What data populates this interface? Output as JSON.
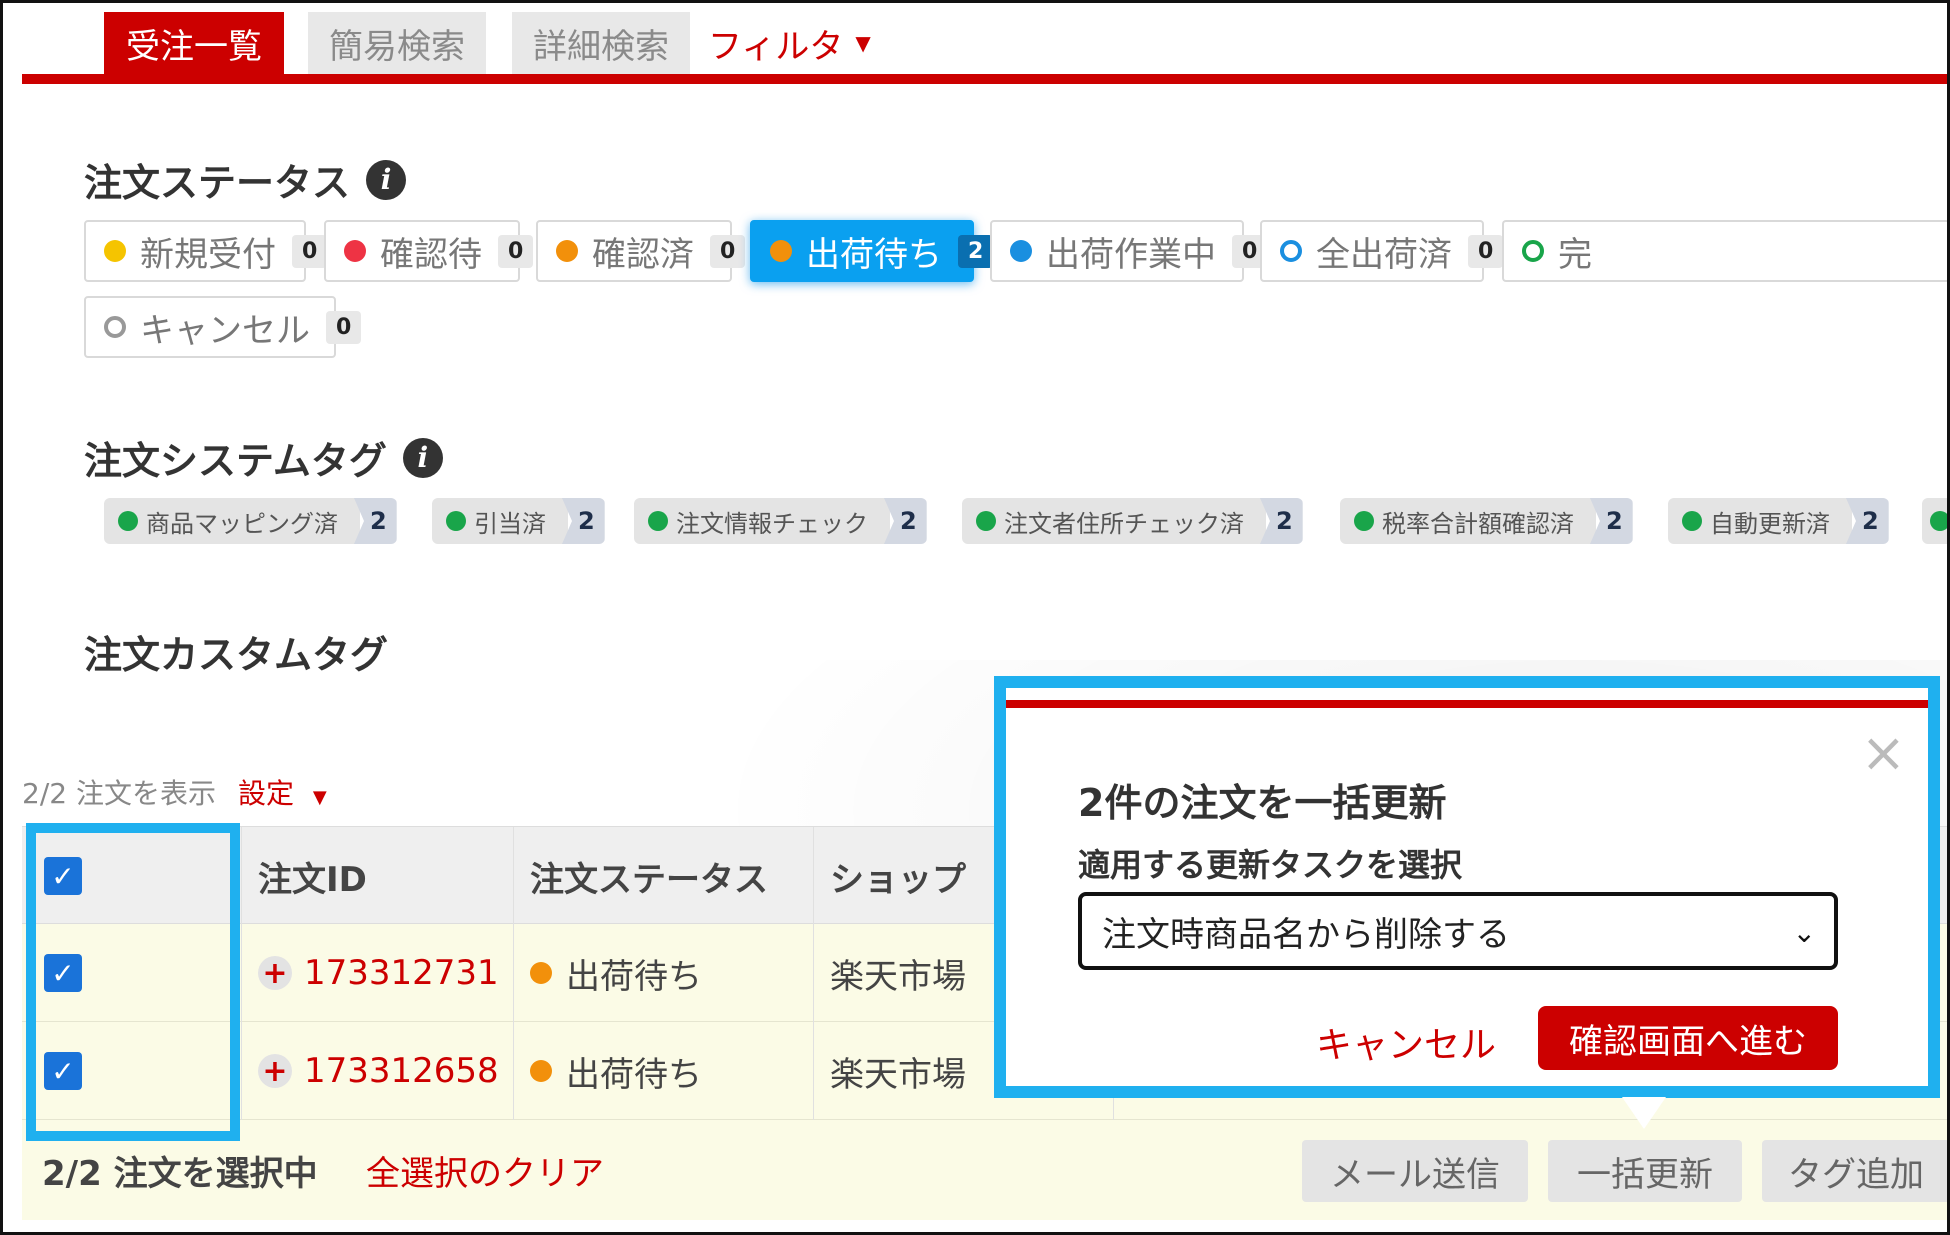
{
  "tabs": {
    "order_list": "受注一覧",
    "simple_search": "簡易検索",
    "detail_search": "詳細検索",
    "filter": "フィルタ",
    "caret": "▼"
  },
  "order_status": {
    "title": "注文ステータス",
    "info": "i",
    "chips": [
      {
        "label": "新規受付",
        "count": "0",
        "color": "#f5c400"
      },
      {
        "label": "確認待",
        "count": "0",
        "color": "#ee3344"
      },
      {
        "label": "確認済",
        "count": "0",
        "color": "#f2900b"
      },
      {
        "label": "出荷待ち",
        "count": "2",
        "color": "#f2900b"
      },
      {
        "label": "出荷作業中",
        "count": "0",
        "color": "#1a8fe0"
      },
      {
        "label": "全出荷済",
        "count": "0",
        "color": "#1a8fe0"
      },
      {
        "label": "完",
        "color": "#19a54a"
      },
      {
        "label": "キャンセル",
        "count": "0",
        "color": "#999999"
      }
    ]
  },
  "system_tags": {
    "title": "注文システムタグ",
    "info": "i",
    "tags": [
      {
        "label": "商品マッピング済",
        "count": "2"
      },
      {
        "label": "引当済",
        "count": "2"
      },
      {
        "label": "注文情報チェック",
        "count": "2"
      },
      {
        "label": "注文者住所チェック済",
        "count": "2"
      },
      {
        "label": "税率合計額確認済",
        "count": "2"
      },
      {
        "label": "自動更新済",
        "count": "2"
      }
    ]
  },
  "custom_tags": {
    "title": "注文カスタムタグ"
  },
  "list": {
    "count_text": "2/2 注文を表示",
    "settings": "設定",
    "caret": "▼"
  },
  "table": {
    "headers": {
      "order_id": "注文ID",
      "status": "注文ステータス",
      "shop": "ショップ"
    },
    "rows": [
      {
        "order_id": "173312731",
        "status": "出荷待ち",
        "shop": "楽天市場"
      },
      {
        "order_id": "173312658",
        "status": "出荷待ち",
        "shop": "楽天市場"
      }
    ]
  },
  "footer": {
    "selected_text": "2/2 注文を選択中",
    "clear_link": "全選択のクリア",
    "actions": {
      "mail": "メール送信",
      "bulk_update": "一括更新",
      "add_tag": "タグ追加"
    }
  },
  "modal": {
    "title": "2件の注文を一括更新",
    "label": "適用する更新タスクを選択",
    "selected_task": "注文時商品名から削除する",
    "cancel": "キャンセル",
    "confirm": "確認画面へ進む",
    "close": "×",
    "chevron": "⌄"
  },
  "colors": {
    "brand_red": "#cc0000",
    "highlight_blue": "#1fb0ef",
    "active_chip_blue": "#0aa0f0",
    "row_yellow": "#fbfbe6"
  }
}
